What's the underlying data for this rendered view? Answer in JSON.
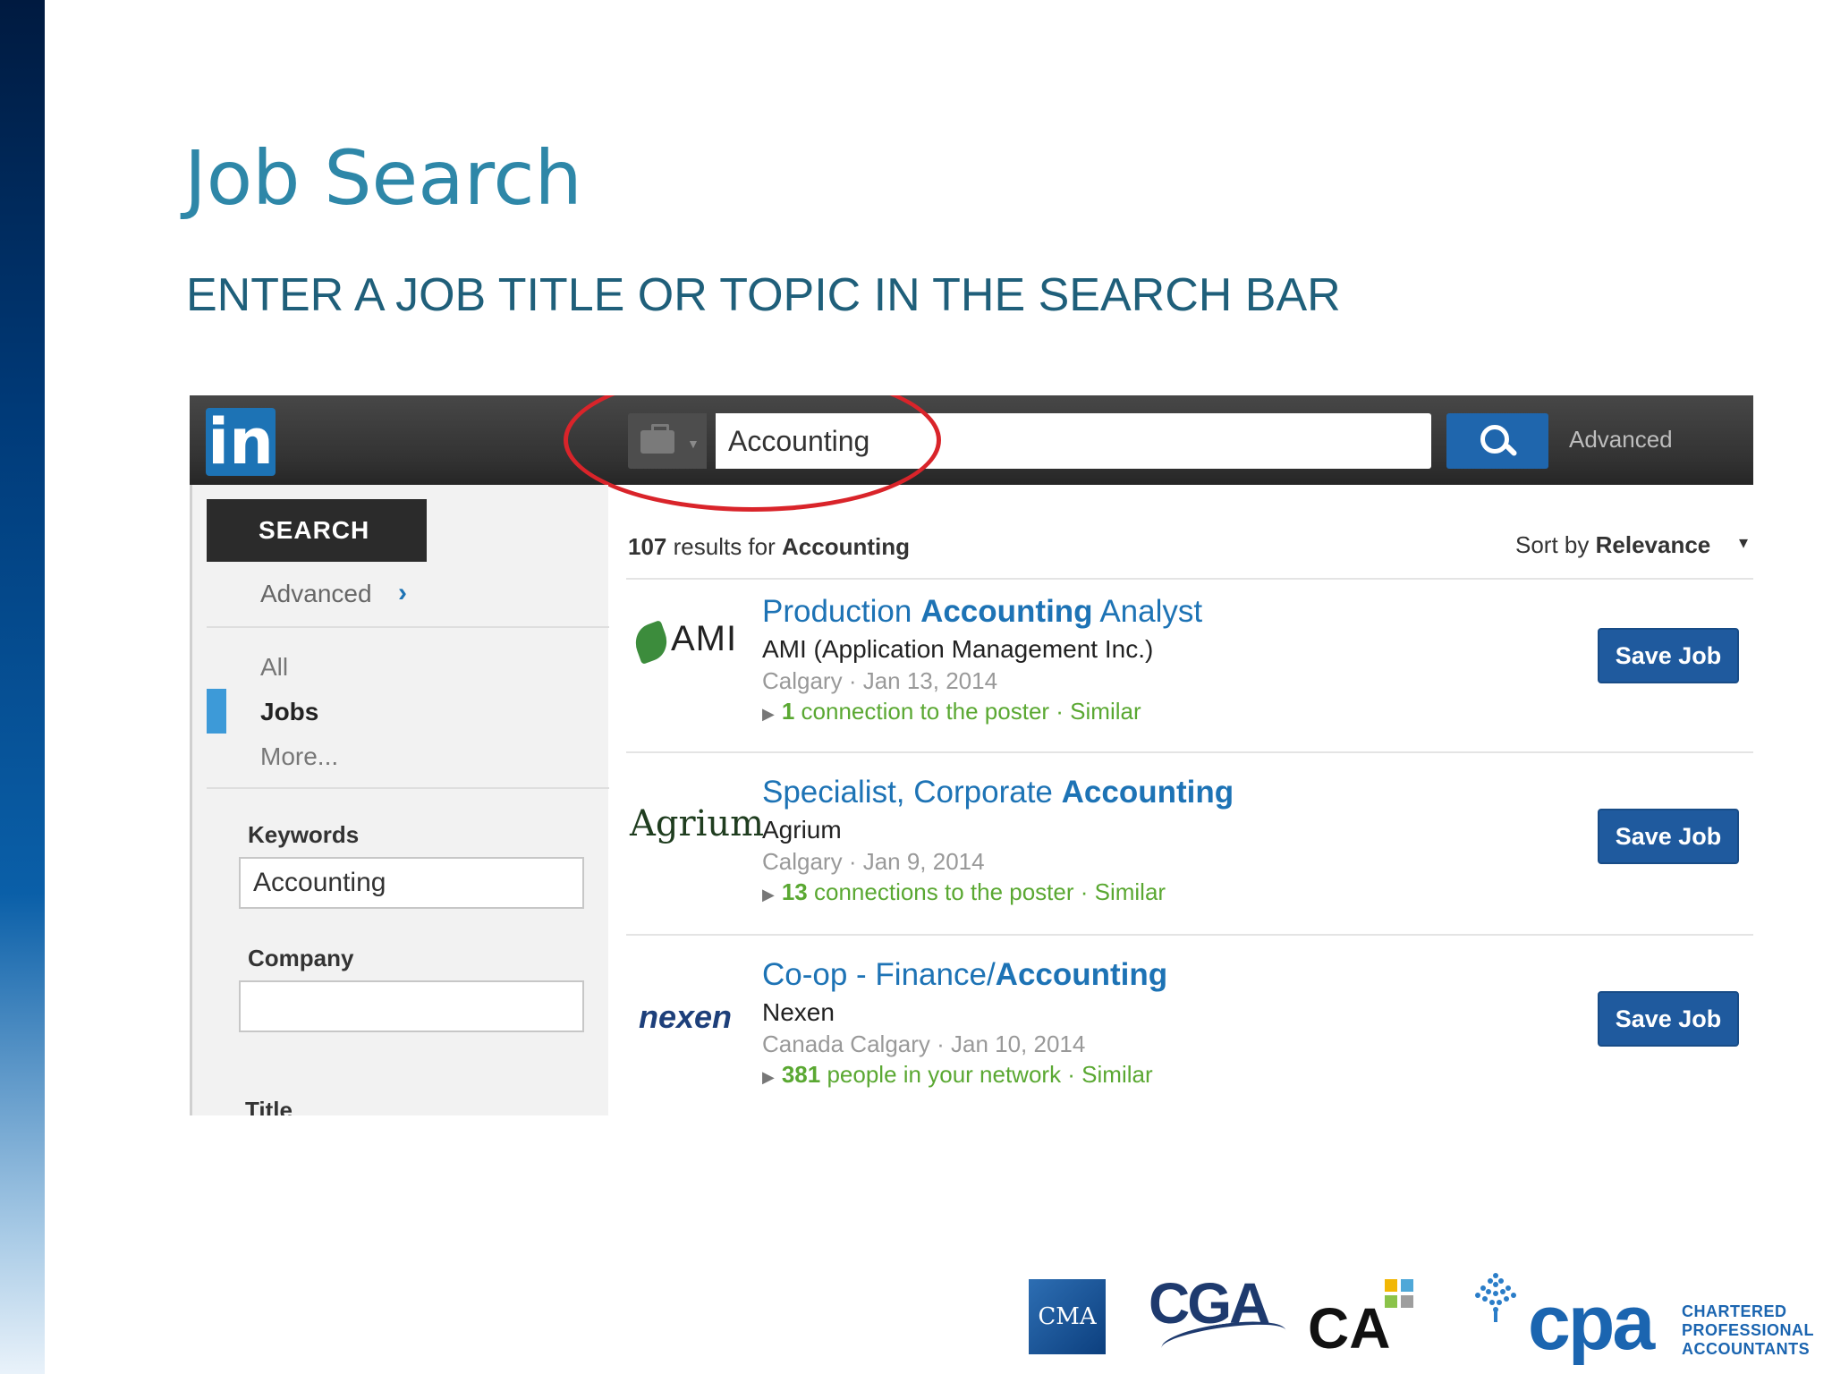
{
  "slide": {
    "title": "Job Search",
    "subtitle": "ENTER A JOB TITLE OR TOPIC IN THE SEARCH BAR"
  },
  "header": {
    "logo_text": "in",
    "search_value": "Accounting",
    "advanced_label": "Advanced"
  },
  "sidebar": {
    "search_tab": "SEARCH",
    "advanced_link": "Advanced",
    "nav": [
      "All",
      "Jobs",
      "More..."
    ],
    "keywords_label": "Keywords",
    "keywords_value": "Accounting",
    "company_label": "Company",
    "company_value": "",
    "title_label": "Title"
  },
  "results": {
    "count": "107",
    "count_text": "results for",
    "query": "Accounting",
    "sort_prefix": "Sort by",
    "sort_value": "Relevance",
    "jobs": [
      {
        "title_pre": "Production ",
        "title_bold": "Accounting",
        "title_post": " Analyst",
        "company": "AMI (Application Management Inc.)",
        "meta": "Calgary · Jan 13, 2014",
        "conn_num": "1",
        "conn_text": "connection to the poster · Similar",
        "logo": "AMI",
        "save_label": "Save Job"
      },
      {
        "title_pre": "Specialist, Corporate ",
        "title_bold": "Accounting",
        "title_post": "",
        "company": "Agrium",
        "meta": "Calgary · Jan 9, 2014",
        "conn_num": "13",
        "conn_text": "connections to the poster · Similar",
        "logo": "Agrium",
        "save_label": "Save Job"
      },
      {
        "title_pre": "Co-op - Finance/",
        "title_bold": "Accounting",
        "title_post": "",
        "company": "Nexen",
        "meta": "Canada Calgary · Jan 10, 2014",
        "conn_num": "381",
        "conn_text": "people in your network · Similar",
        "logo": "nexen",
        "save_label": "Save Job"
      }
    ]
  },
  "footer": {
    "cma": "CMA",
    "cga": "CGA",
    "ca": "CA",
    "cpa": "cpa",
    "cpa_line1": "CHARTERED",
    "cpa_line2": "PROFESSIONAL",
    "cpa_line3": "ACCOUNTANTS"
  },
  "colors": {
    "title_teal": "#2e87a8",
    "linkedin_blue": "#1d73b5",
    "highlight_red": "#d9242a",
    "connection_green": "#5aa832"
  }
}
